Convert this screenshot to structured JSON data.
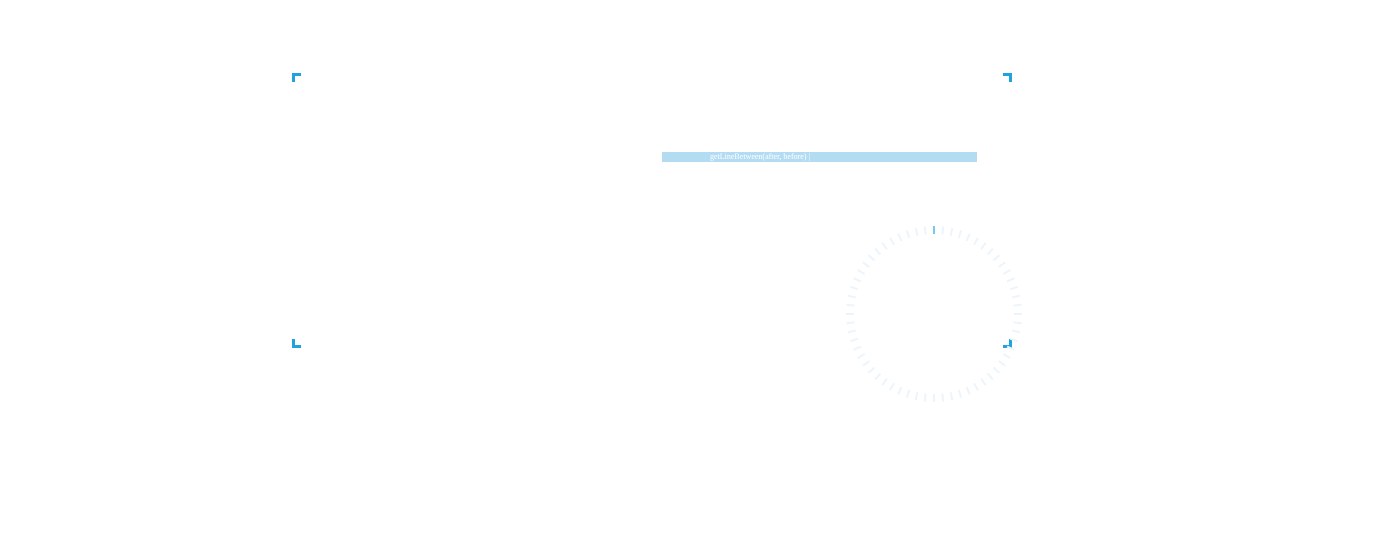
{
  "code_bar": {
    "text": "getLineBetween(after, before) |"
  },
  "colors": {
    "accent": "#1fa3dc",
    "highlight": "#b3dcf2",
    "tick": "#ecf5fb",
    "text": "#ffffff"
  },
  "icons": {
    "frame_corners": "bracket-corner-icon",
    "dial": "radial-tick-dial-icon"
  }
}
